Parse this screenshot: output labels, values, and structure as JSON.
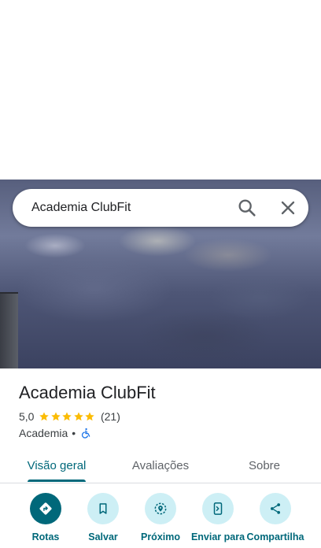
{
  "search": {
    "query": "Academia ClubFit"
  },
  "place": {
    "name": "Academia ClubFit",
    "rating": "5,0",
    "stars": 5,
    "review_count": "(21)",
    "category": "Academia",
    "separator": "•"
  },
  "tabs": [
    {
      "label": "Visão geral",
      "active": true
    },
    {
      "label": "Avaliações",
      "active": false
    },
    {
      "label": "Sobre",
      "active": false
    }
  ],
  "actions": [
    {
      "label": "Rotas",
      "icon": "directions-icon"
    },
    {
      "label": "Salvar",
      "icon": "bookmark-icon"
    },
    {
      "label": "Próximo",
      "icon": "nearby-icon"
    },
    {
      "label": "Enviar para",
      "icon": "send-to-phone-icon"
    },
    {
      "label": "Compartilha",
      "icon": "share-icon"
    }
  ],
  "colors": {
    "accent": "#00687a",
    "action_bg": "#cdeff5",
    "star": "#fbbc04",
    "accessibility": "#1a73e8"
  }
}
